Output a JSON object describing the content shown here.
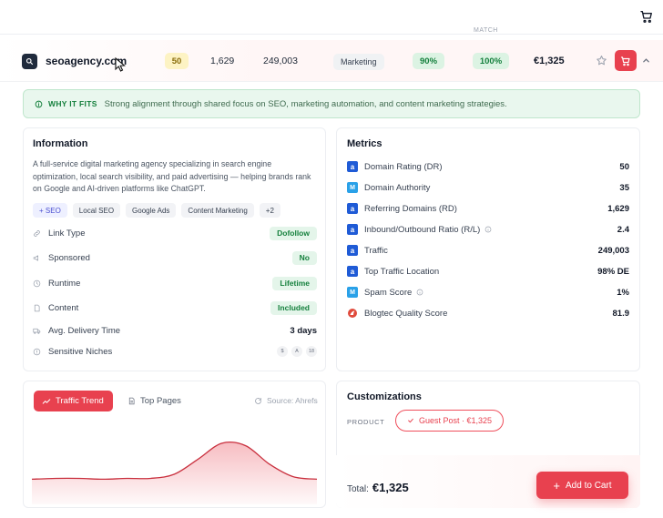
{
  "header": {
    "faded_column": "MATCH"
  },
  "row": {
    "domain": "seoagency.com",
    "dr_badge": "50",
    "referring_domains": "1,629",
    "traffic": "249,003",
    "category": "Marketing",
    "score_a": "90%",
    "score_b": "100%",
    "price": "€1,325"
  },
  "fits": {
    "label": "WHY IT FITS",
    "text": "Strong alignment through shared focus on SEO, marketing automation, and content marketing strategies."
  },
  "information": {
    "title": "Information",
    "description": "A full-service digital marketing agency specializing in search engine optimization, local search visibility, and paid advertising — helping brands rank on Google and AI-driven platforms like ChatGPT.",
    "tags": [
      "+ SEO",
      "Local SEO",
      "Google Ads",
      "Content Marketing",
      "+2"
    ],
    "rows": [
      {
        "icon": "link-icon",
        "label": "Link Type",
        "value": "Dofollow",
        "kind": "badge"
      },
      {
        "icon": "megaphone-icon",
        "label": "Sponsored",
        "value": "No",
        "kind": "badge"
      },
      {
        "icon": "clock-icon",
        "label": "Runtime",
        "value": "Lifetime",
        "kind": "badge"
      },
      {
        "icon": "document-icon",
        "label": "Content",
        "value": "Included",
        "kind": "badge"
      },
      {
        "icon": "truck-icon",
        "label": "Avg. Delivery Time",
        "value": "3 days",
        "kind": "text"
      },
      {
        "icon": "warning-icon",
        "label": "Sensitive Niches",
        "value": "",
        "kind": "dots"
      }
    ],
    "niches": [
      "$",
      "A",
      "18"
    ]
  },
  "metrics": {
    "title": "Metrics",
    "rows": [
      {
        "source": "ahrefs",
        "glyph": "a",
        "label": "Domain Rating (DR)",
        "value": "50",
        "info": false
      },
      {
        "source": "moz",
        "glyph": "M",
        "label": "Domain Authority",
        "value": "35",
        "info": false
      },
      {
        "source": "ahrefs",
        "glyph": "a",
        "label": "Referring Domains (RD)",
        "value": "1,629",
        "info": false
      },
      {
        "source": "ahrefs",
        "glyph": "a",
        "label": "Inbound/Outbound Ratio (R/L)",
        "value": "2.4",
        "info": true
      },
      {
        "source": "ahrefs",
        "glyph": "a",
        "label": "Traffic",
        "value": "249,003",
        "info": false
      },
      {
        "source": "ahrefs",
        "glyph": "a",
        "label": "Top Traffic Location",
        "value": "98% DE",
        "info": false
      },
      {
        "source": "moz",
        "glyph": "M",
        "label": "Spam Score",
        "value": "1%",
        "info": true
      },
      {
        "source": "blogtec",
        "glyph": "",
        "label": "Blogtec Quality Score",
        "value": "81.9",
        "info": false
      }
    ]
  },
  "trend": {
    "tab_active": "Traffic Trend",
    "tab_other": "Top Pages",
    "source": "Source: Ahrefs",
    "accent": "#e8414f"
  },
  "chart_data": {
    "type": "area",
    "title": "",
    "xlabel": "",
    "ylabel": "",
    "x": [
      0,
      1,
      2,
      3,
      4,
      5,
      6,
      7,
      8,
      9,
      10,
      11,
      12
    ],
    "values": [
      30,
      31,
      31,
      30,
      31,
      31,
      36,
      54,
      73,
      70,
      48,
      33,
      30
    ],
    "ylim": [
      0,
      100
    ],
    "grid": false,
    "legend": "none"
  },
  "customizations": {
    "title": "Customizations",
    "product_label": "PRODUCT",
    "product_pill": "Guest Post · €1,325",
    "total_label": "Total:",
    "total_value": "€1,325",
    "add_to_cart": "Add to Cart"
  },
  "colors": {
    "accent": "#e8414f",
    "success": "#15803d",
    "dark": "#1f2a3c"
  }
}
